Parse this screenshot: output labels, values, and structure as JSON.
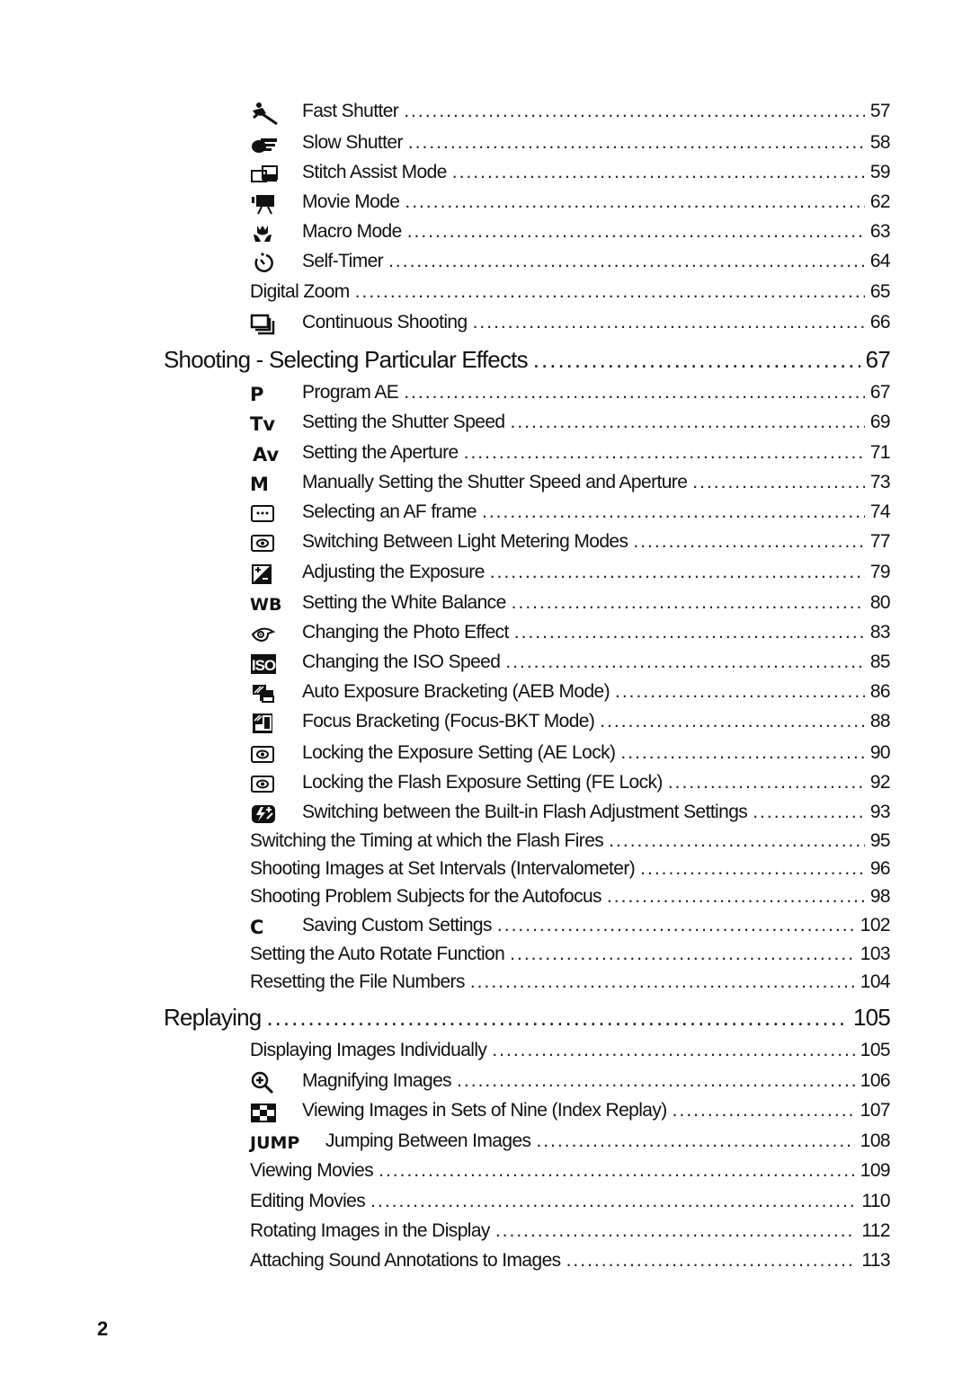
{
  "entries": [
    {
      "icon": "fast-shutter-icon",
      "label": "Fast Shutter",
      "page": "57"
    },
    {
      "icon": "slow-shutter-icon",
      "label": "Slow Shutter",
      "page": "58"
    },
    {
      "icon": "stitch-assist-icon",
      "label": "Stitch Assist Mode",
      "page": "59"
    },
    {
      "icon": "movie-camera-icon",
      "label": "Movie Mode",
      "page": "62"
    },
    {
      "icon": "macro-flower-icon",
      "label": "Macro Mode",
      "page": "63"
    },
    {
      "icon": "self-timer-icon",
      "label": "Self-Timer",
      "page": "64"
    },
    {
      "icon": null,
      "label": "Digital Zoom",
      "page": "65"
    },
    {
      "icon": "continuous-shooting-icon",
      "label": "Continuous Shooting",
      "page": "66"
    },
    {
      "section": true,
      "label": "Shooting - Selecting Particular Effects",
      "page": "67"
    },
    {
      "icon": "program-ae-icon",
      "icon_text": "P",
      "label": "Program AE",
      "page": "67"
    },
    {
      "icon": "tv-mode-icon",
      "icon_text": "Tv",
      "label": "Setting the Shutter Speed",
      "page": "69"
    },
    {
      "icon": "av-mode-icon",
      "icon_text": "Av",
      "label": "Setting the Aperture",
      "page": "71"
    },
    {
      "icon": "manual-mode-icon",
      "icon_text": "M",
      "label": "Manually Setting the Shutter Speed and Aperture",
      "page": "73"
    },
    {
      "icon": "af-frame-icon",
      "label": "Selecting an AF frame",
      "page": "74"
    },
    {
      "icon": "metering-icon",
      "label": "Switching Between Light Metering Modes",
      "page": "77"
    },
    {
      "icon": "exposure-compensation-icon",
      "label": "Adjusting the Exposure",
      "page": "79"
    },
    {
      "icon": "white-balance-icon",
      "icon_text": "WB",
      "label": "Setting the White Balance",
      "page": "80"
    },
    {
      "icon": "photo-effect-icon",
      "label": "Changing the  Photo Effect",
      "page": "83"
    },
    {
      "icon": "iso-icon",
      "icon_text": "ISO",
      "label": "Changing the ISO Speed",
      "page": "85"
    },
    {
      "icon": "aeb-icon",
      "label": "Auto Exposure Bracketing (AEB Mode)",
      "page": "86"
    },
    {
      "icon": "focus-bracketing-icon",
      "label": "Focus Bracketing (Focus-BKT Mode)",
      "page": "88"
    },
    {
      "icon": "metering-icon",
      "label": "Locking the Exposure Setting (AE Lock)",
      "page": "90"
    },
    {
      "icon": "metering-icon",
      "label": "Locking the Flash Exposure Setting (FE Lock)",
      "page": "92"
    },
    {
      "icon": "flash-adjust-icon",
      "label": "Switching between the Built-in Flash Adjustment Settings",
      "page": "93"
    },
    {
      "icon": null,
      "label": "Switching the Timing at which the Flash Fires",
      "page": "95"
    },
    {
      "icon": null,
      "label": "Shooting Images at Set Intervals (Intervalometer)",
      "page": "96"
    },
    {
      "icon": null,
      "label": "Shooting Problem Subjects for the Autofocus",
      "page": "98"
    },
    {
      "icon": "custom-settings-icon",
      "icon_text": "C",
      "label": "Saving Custom Settings",
      "page": "102"
    },
    {
      "icon": null,
      "label": "Setting the Auto Rotate Function",
      "page": "103"
    },
    {
      "icon": null,
      "label": "Resetting the File Numbers",
      "page": "104"
    },
    {
      "section": true,
      "label": "Replaying",
      "page": "105"
    },
    {
      "icon": null,
      "label": "Displaying Images Individually",
      "page": "105"
    },
    {
      "icon": "magnify-icon",
      "label": "Magnifying Images",
      "page": "106"
    },
    {
      "icon": "index-replay-icon",
      "label": "Viewing Images in Sets of Nine (Index Replay)",
      "page": "107"
    },
    {
      "icon": "jump-icon",
      "icon_text": "JUMP",
      "label": "Jumping Between Images",
      "page": "108"
    },
    {
      "icon": null,
      "label": "Viewing Movies",
      "page": "109"
    },
    {
      "icon": null,
      "label": "Editing Movies",
      "page": "110"
    },
    {
      "icon": null,
      "label": "Rotating Images in the Display",
      "page": "112"
    },
    {
      "icon": null,
      "label": "Attaching Sound Annotations to Images",
      "page": "113"
    }
  ],
  "page_number": "2"
}
